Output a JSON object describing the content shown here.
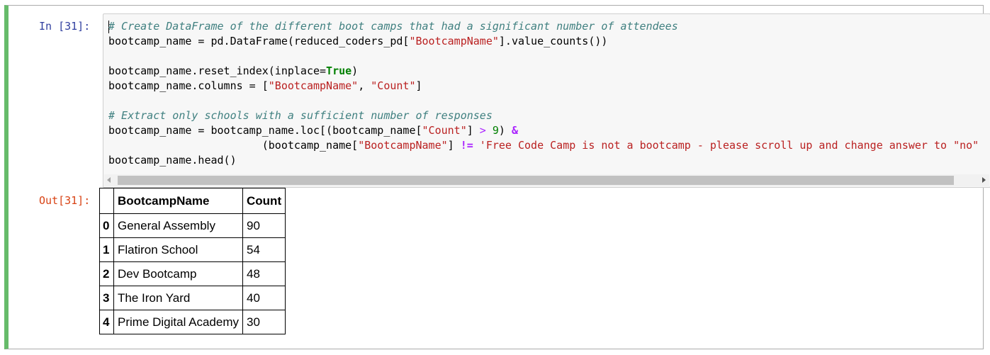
{
  "cell": {
    "input_prompt": "In [31]:",
    "output_prompt": "Out[31]:"
  },
  "code": {
    "line1_comment": "# Create DataFrame of the different boot camps that had a significant number of attendees",
    "line2_a": "bootcamp_name = pd.DataFrame(reduced_coders_pd[",
    "line2_str": "\"BootcampName\"",
    "line2_b": "].value_counts())",
    "line4_a": "bootcamp_name.reset_index(inplace=",
    "line4_kw": "True",
    "line4_b": ")",
    "line5_a": "bootcamp_name.columns = [",
    "line5_str1": "\"BootcampName\"",
    "line5_sep": ", ",
    "line5_str2": "\"Count\"",
    "line5_b": "]",
    "line7_comment": "# Extract only schools with a sufficient number of responses",
    "line8_a": "bootcamp_name = bootcamp_name.loc[(bootcamp_name[",
    "line8_str": "\"Count\"",
    "line8_b": "] ",
    "line8_op": ">",
    "line8_c": " ",
    "line8_num": "9",
    "line8_d": ") ",
    "line8_amp": "&",
    "line9_a": "                        (bootcamp_name[",
    "line9_str": "\"BootcampName\"",
    "line9_b": "] ",
    "line9_op": "!=",
    "line9_c": " ",
    "line9_str2": "'Free Code Camp is not a bootcamp - please scroll up and change answer to \"no\"",
    "line10": "bootcamp_name.head()"
  },
  "table": {
    "columns": [
      "",
      "BootcampName",
      "Count"
    ],
    "rows": [
      {
        "index": "0",
        "name": "General Assembly",
        "count": "90"
      },
      {
        "index": "1",
        "name": "Flatiron School",
        "count": "54"
      },
      {
        "index": "2",
        "name": "Dev Bootcamp",
        "count": "48"
      },
      {
        "index": "3",
        "name": "The Iron Yard",
        "count": "40"
      },
      {
        "index": "4",
        "name": "Prime Digital Academy",
        "count": "30"
      }
    ]
  },
  "icons": {
    "scroll_left": "chevron-left-icon",
    "scroll_right": "chevron-right-icon"
  },
  "colors": {
    "cell_border_active": "#66bb6a",
    "input_prompt": "#303f9f",
    "output_prompt": "#d84315",
    "comment": "#408080",
    "string": "#ba2121",
    "keyword": "#008000",
    "operator": "#aa22ff"
  }
}
